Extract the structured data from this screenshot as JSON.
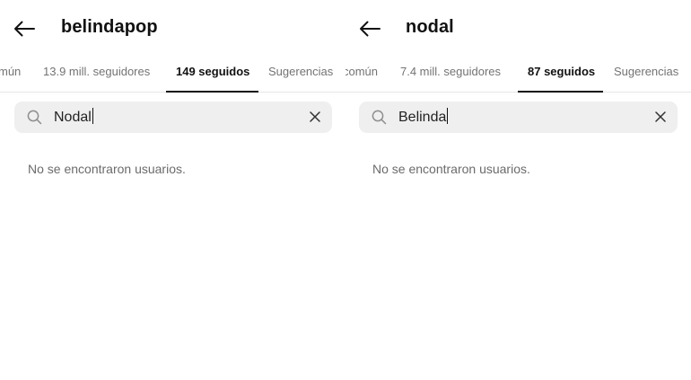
{
  "left": {
    "title": "belindapop",
    "tabs": [
      "mún",
      "13.9 mill. seguidores",
      "149 seguidos",
      "Sugerencias"
    ],
    "search_value": "Nodal",
    "empty_message": "No se encontraron usuarios."
  },
  "right": {
    "title": "nodal",
    "tabs": [
      "común",
      "7.4 mill. seguidores",
      "87 seguidos",
      "Sugerencias"
    ],
    "search_value": "Belinda",
    "empty_message": "No se encontraron usuarios."
  },
  "icons": {
    "back": "arrow-left-icon",
    "search": "search-icon",
    "clear": "close-icon"
  },
  "colors": {
    "active_tab": "#111111",
    "inactive_tab": "#737373",
    "search_bg": "#efefef"
  }
}
